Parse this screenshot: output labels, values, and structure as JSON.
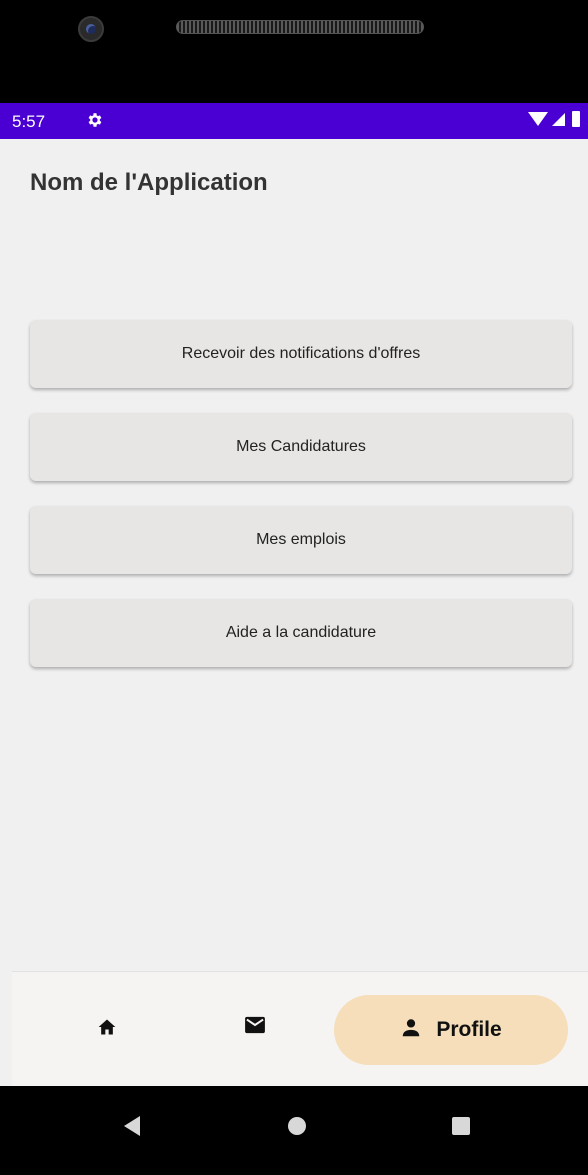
{
  "status_bar": {
    "time": "5:57",
    "gear_icon": "gear-icon",
    "wifi_icon": "wifi-icon",
    "signal_icon": "signal-icon",
    "battery_icon": "battery-icon",
    "background_color": "#4a00d3"
  },
  "app": {
    "title": "Nom de l'Application",
    "background_color": "#f0f0f0"
  },
  "menu": {
    "items": [
      {
        "label": "Recevoir des notifications d'offres"
      },
      {
        "label": "Mes Candidatures"
      },
      {
        "label": "Mes emplois"
      },
      {
        "label": "Aide a la candidature"
      }
    ]
  },
  "bottom_nav": {
    "items": [
      {
        "icon": "home-icon",
        "selected": false
      },
      {
        "icon": "mail-icon",
        "selected": false
      },
      {
        "icon": "person-icon",
        "label": "Profile",
        "selected": true
      }
    ],
    "selected_color": "#f5deb9"
  },
  "system_nav": {
    "back_icon": "back-icon",
    "home_icon": "home-circle-icon",
    "recents_icon": "recents-icon"
  }
}
